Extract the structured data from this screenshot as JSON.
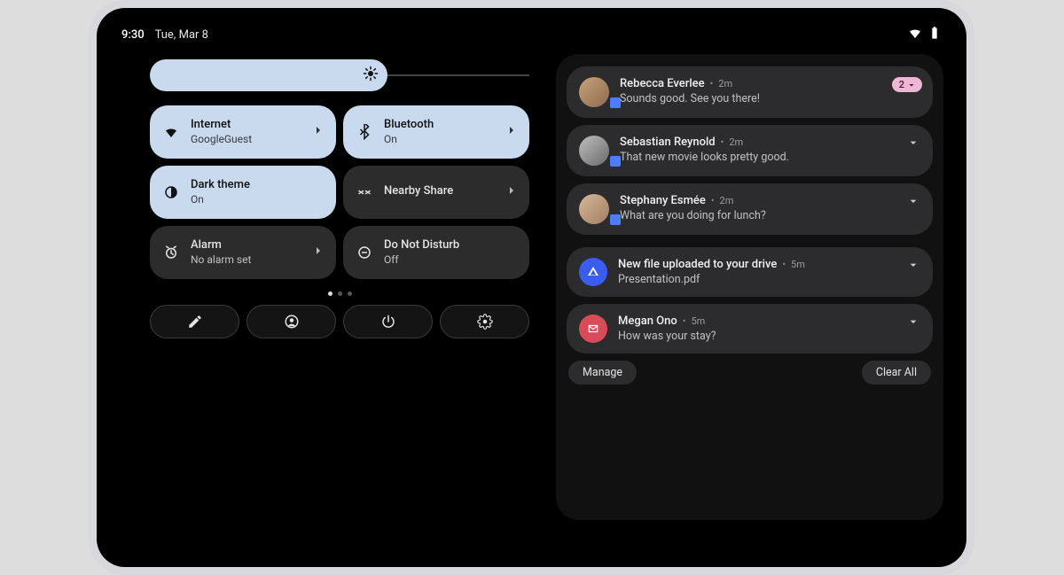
{
  "status": {
    "time": "9:30",
    "date": "Tue, Mar 8"
  },
  "tiles": {
    "internet": {
      "label": "Internet",
      "sub": "GoogleGuest"
    },
    "bluetooth": {
      "label": "Bluetooth",
      "sub": "On"
    },
    "dark": {
      "label": "Dark theme",
      "sub": "On"
    },
    "nearby": {
      "label": "Nearby Share",
      "sub": ""
    },
    "alarm": {
      "label": "Alarm",
      "sub": "No alarm set"
    },
    "dnd": {
      "label": "Do Not Disturb",
      "sub": "Off"
    }
  },
  "notifications": [
    {
      "title": "Rebecca Everlee",
      "time": "2m",
      "msg": "Sounds good. See you there!",
      "badge": "2"
    },
    {
      "title": "Sebastian Reynold",
      "time": "2m",
      "msg": "That new movie looks pretty good."
    },
    {
      "title": "Stephany Esmée",
      "time": "2m",
      "msg": "What are you doing for lunch?"
    },
    {
      "title": "New file uploaded to your drive",
      "time": "5m",
      "msg": "Presentation.pdf"
    },
    {
      "title": "Megan Ono",
      "time": "5m",
      "msg": "How was your stay?"
    }
  ],
  "footer": {
    "manage": "Manage",
    "clear": "Clear All"
  }
}
